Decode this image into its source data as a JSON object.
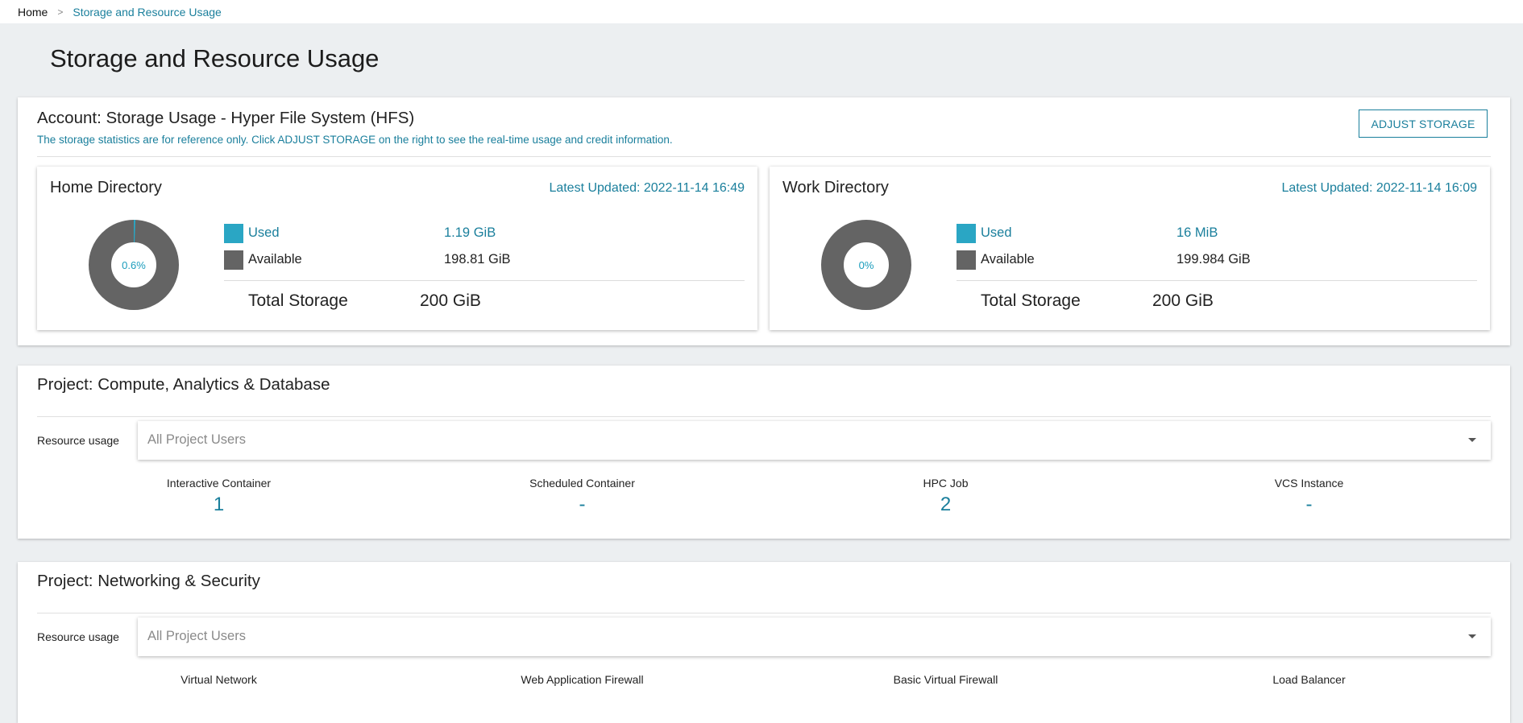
{
  "breadcrumb": {
    "home": "Home",
    "separator": ">",
    "current": "Storage and Resource Usage"
  },
  "page_title": "Storage and Resource Usage",
  "account": {
    "title": "Account: Storage Usage - Hyper File System (HFS)",
    "note": "The storage statistics are for reference only. Click ADJUST STORAGE on the right to see the real-time usage and credit information.",
    "adjust_button": "ADJUST STORAGE",
    "home": {
      "title": "Home Directory",
      "updated": "Latest Updated: 2022-11-14 16:49",
      "percent_label": "0.6%",
      "used_fraction": 0.006,
      "used_label": "Used",
      "used_value": "1.19 GiB",
      "available_label": "Available",
      "available_value": "198.81 GiB",
      "total_label": "Total Storage",
      "total_value": "200 GiB"
    },
    "work": {
      "title": "Work Directory",
      "updated": "Latest Updated: 2022-11-14 16:09",
      "percent_label": "0%",
      "used_fraction": 0.0,
      "used_label": "Used",
      "used_value": "16 MiB",
      "available_label": "Available",
      "available_value": "199.984 GiB",
      "total_label": "Total Storage",
      "total_value": "200 GiB"
    }
  },
  "compute": {
    "title": "Project: Compute, Analytics & Database",
    "resource_label": "Resource usage",
    "select_value": "All Project Users",
    "stats": [
      {
        "label": "Interactive Container",
        "value": "1"
      },
      {
        "label": "Scheduled Container",
        "value": "-"
      },
      {
        "label": "HPC Job",
        "value": "2"
      },
      {
        "label": "VCS Instance",
        "value": "-"
      }
    ]
  },
  "network": {
    "title": "Project: Networking & Security",
    "resource_label": "Resource usage",
    "select_value": "All Project Users",
    "stats": [
      {
        "label": "Virtual Network"
      },
      {
        "label": "Web Application Firewall"
      },
      {
        "label": "Basic Virtual Firewall"
      },
      {
        "label": "Load Balancer"
      }
    ]
  },
  "colors": {
    "used": "#2aa6c4",
    "available": "#646464",
    "accent": "#1a7f9c"
  }
}
